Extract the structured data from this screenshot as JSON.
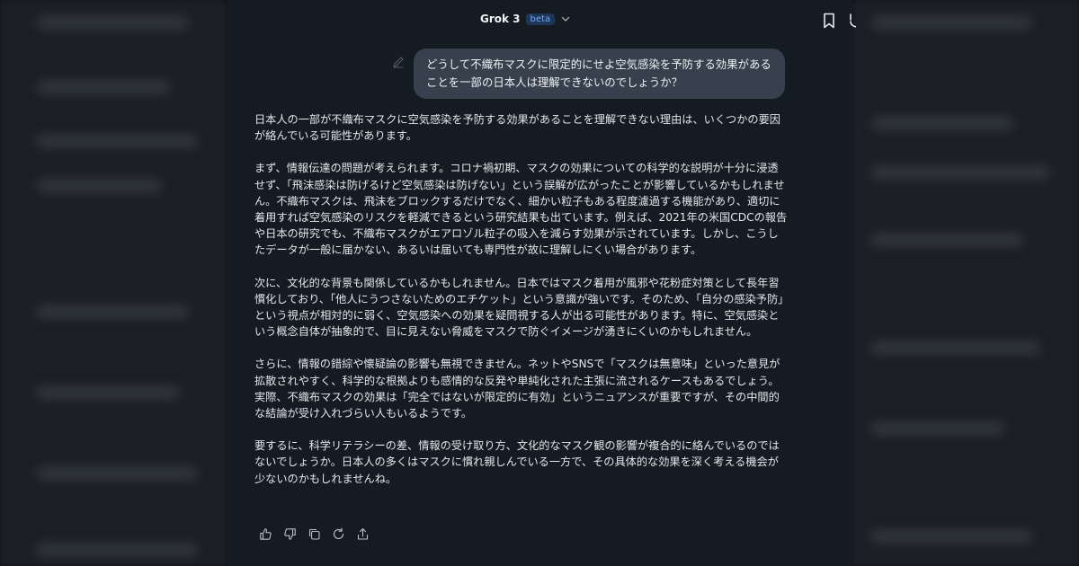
{
  "header": {
    "model_name": "Grok 3",
    "badge": "beta"
  },
  "user_message": {
    "text": "どうして不織布マスクに限定的にせよ空気感染を予防する効果があることを一部の日本人は理解できないのでしょうか？"
  },
  "assistant_message": {
    "paragraphs": [
      "日本人の一部が不織布マスクに空気感染を予防する効果があることを理解できない理由は、いくつかの要因が絡んでいる可能性があります。",
      "まず、情報伝達の問題が考えられます。コロナ禍初期、マスクの効果についての科学的な説明が十分に浸透せず、「飛沫感染は防げるけど空気感染は防げない」という誤解が広がったことが影響しているかもしれません。不織布マスクは、飛沫をブロックするだけでなく、細かい粒子もある程度濾過する機能があり、適切に着用すれば空気感染のリスクを軽減できるという研究結果も出ています。例えば、2021年の米国CDCの報告や日本の研究でも、不織布マスクがエアロゾル粒子の吸入を減らす効果が示されています。しかし、こうしたデータが一般に届かない、あるいは届いても専門性が故に理解しにくい場合があります。",
      "次に、文化的な背景も関係しているかもしれません。日本ではマスク着用が風邪や花粉症対策として長年習慣化しており、「他人にうつさないためのエチケット」という意識が強いです。そのため、「自分の感染予防」という視点が相対的に弱く、空気感染への効果を疑問視する人が出る可能性があります。特に、空気感染という概念自体が抽象的で、目に見えない脅威をマスクで防ぐイメージが湧きにくいのかもしれません。",
      "さらに、情報の錯綜や懐疑論の影響も無視できません。ネットやSNSで「マスクは無意味」といった意見が拡散されやすく、科学的な根拠よりも感情的な反発や単純化された主張に流されるケースもあるでしょう。実際、不織布マスクの効果は「完全ではないが限定的に有効」というニュアンスが重要ですが、その中間的な結論が受け入れづらい人もいるようです。",
      "要するに、科学リテラシーの差、情報の受け取り方、文化的なマスク観の影響が複合的に絡んでいるのではないでしょうか。日本人の多くはマスクに慣れ親しんでいる一方で、その具体的な効果を深く考える機会が少ないのかもしれませんね。"
    ]
  },
  "actions": {
    "icons": [
      "thumbs-up-icon",
      "thumbs-down-icon",
      "copy-icon",
      "regenerate-icon",
      "share-icon"
    ]
  },
  "colors": {
    "panel_bg": "#141b22",
    "bubble_bg": "#36414d",
    "badge_text": "#6aa9ff"
  }
}
